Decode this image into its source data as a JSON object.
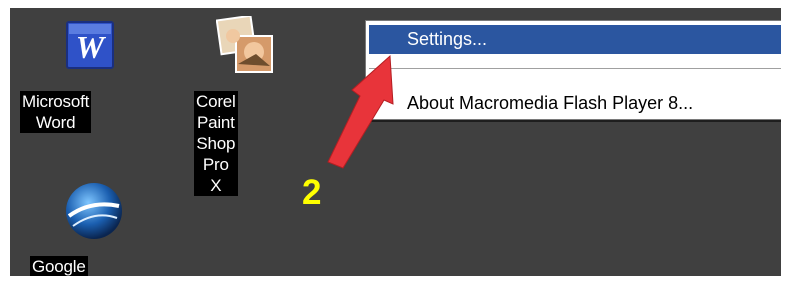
{
  "desktop": {
    "icons": [
      {
        "label": "Microsoft Word",
        "icon": "word-icon"
      },
      {
        "label_line1": "Corel Paint",
        "label_line2": "Shop Pro X",
        "icon": "corel-paint-shop-icon"
      },
      {
        "label": "Google Earth",
        "icon": "google-earth-icon"
      }
    ],
    "background_color": "#404040"
  },
  "context_menu": {
    "items": [
      {
        "label": "Settings...",
        "selected": true
      },
      {
        "label": "About Macromedia Flash Player 8...",
        "selected": false
      }
    ],
    "highlight_color": "#2b56a0"
  },
  "annotation": {
    "step_number": "2",
    "arrow_color": "#e8343a",
    "number_color": "#ffff00"
  }
}
